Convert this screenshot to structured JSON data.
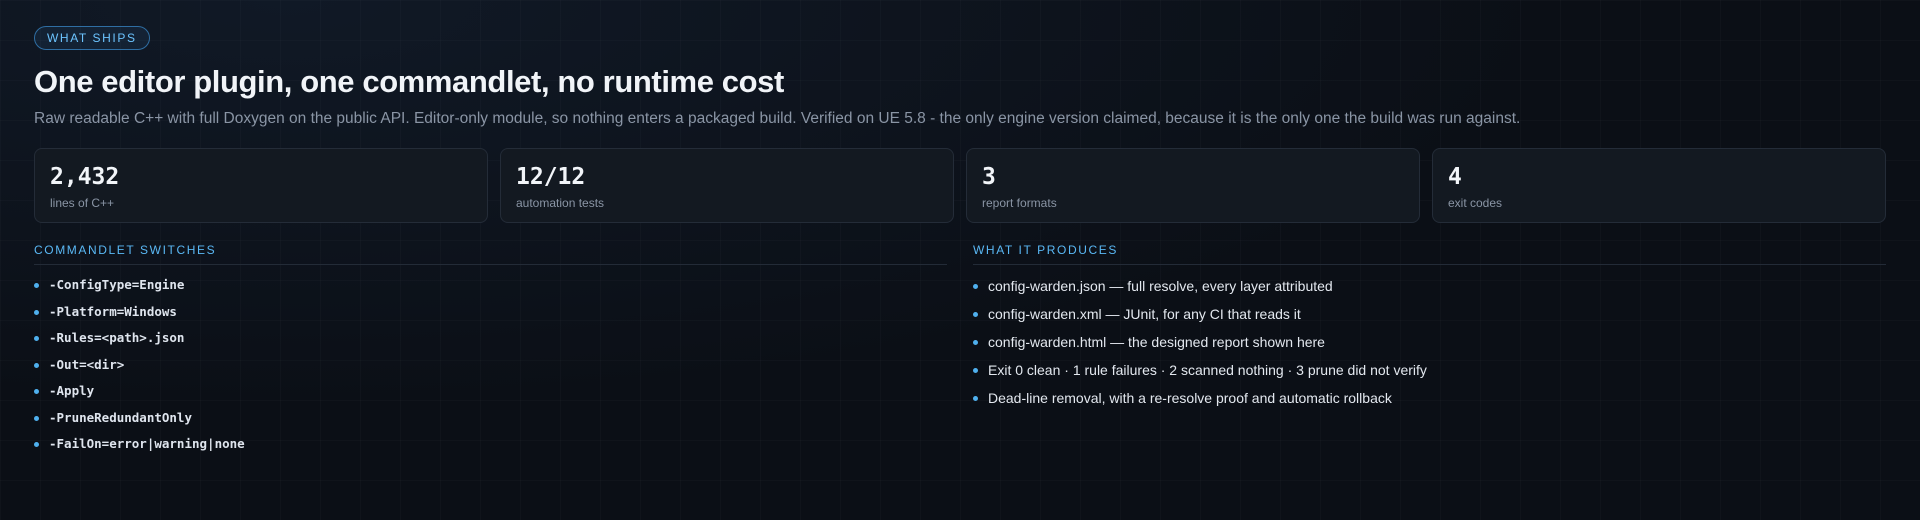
{
  "header": {
    "badge": "WHAT SHIPS",
    "title": "One editor plugin, one commandlet, no runtime cost",
    "subtitle": "Raw readable C++ with full Doxygen on the public API. Editor-only module, so nothing enters a packaged build. Verified on UE 5.8 - the only engine version claimed, because it is the only one the build was run against."
  },
  "stats": [
    {
      "value": "2,432",
      "label": "lines of C++"
    },
    {
      "value": "12/12",
      "label": "automation tests"
    },
    {
      "value": "3",
      "label": "report formats"
    },
    {
      "value": "4",
      "label": "exit codes"
    }
  ],
  "switches": {
    "heading": "COMMANDLET SWITCHES",
    "items": [
      "-ConfigType=Engine",
      "-Platform=Windows",
      "-Rules=<path>.json",
      "-Out=<dir>",
      "-Apply",
      "-PruneRedundantOnly",
      "-FailOn=error|warning|none"
    ]
  },
  "produces": {
    "heading": "WHAT IT PRODUCES",
    "items": [
      "config-warden.json — full resolve, every layer attributed",
      "config-warden.xml — JUnit, for any CI that reads it",
      "config-warden.html — the designed report shown here",
      "Exit 0 clean · 1 rule failures · 2 scanned nothing · 3 prune did not verify",
      "Dead-line removal, with a re-resolve proof and automatic rollback"
    ]
  },
  "colors": {
    "background": "#0b0f16",
    "accent": "#5ab8f5",
    "card": "#131921"
  }
}
